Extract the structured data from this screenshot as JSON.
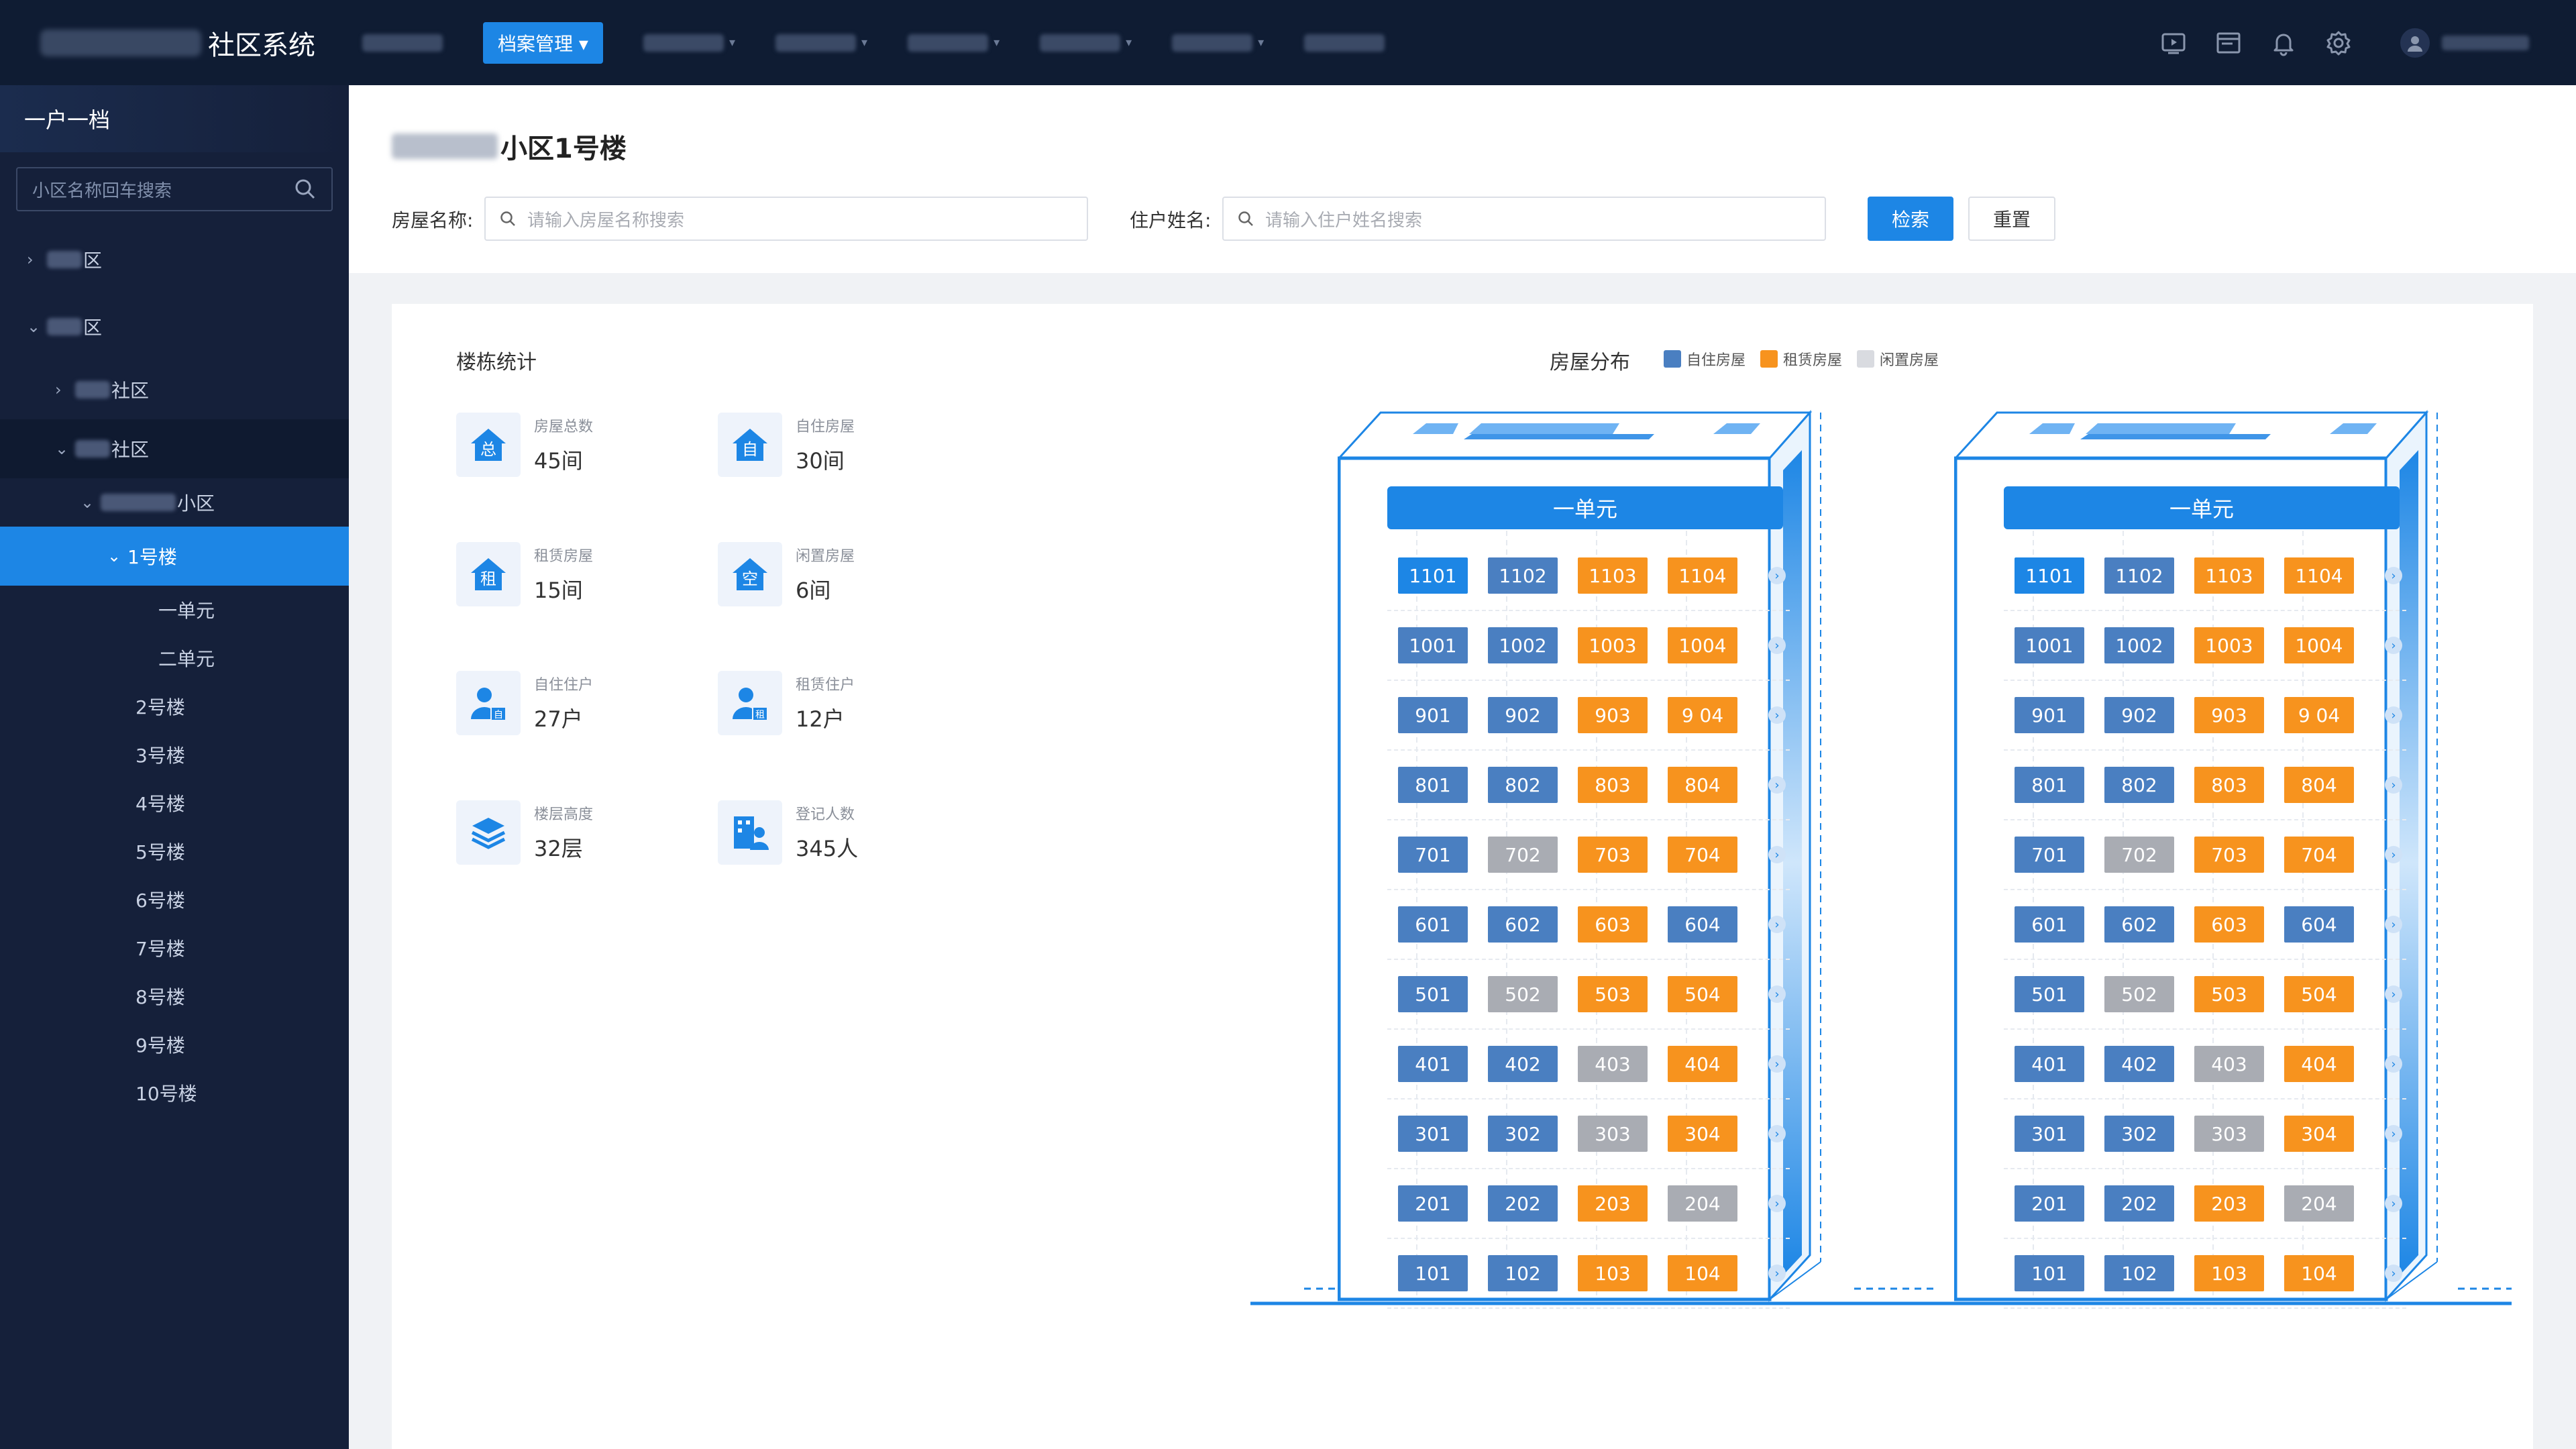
{
  "app": {
    "title_suffix": "社区系统"
  },
  "menu": {
    "active_label": "档案管理 ▾"
  },
  "sidebar": {
    "title": "一户一档",
    "search_placeholder": "小区名称回车搜索",
    "tree": [
      {
        "label": "区",
        "level": 0,
        "state": "collapsed"
      },
      {
        "label": "区",
        "level": 0,
        "state": "expanded"
      },
      {
        "label": "社区",
        "level": 1,
        "state": "collapsed"
      },
      {
        "label": "社区",
        "level": 1,
        "state": "expanded"
      },
      {
        "label": "小区",
        "level": 2,
        "state": "expanded"
      },
      {
        "label": "1号楼",
        "level": 3,
        "state": "selected"
      },
      {
        "label": "一单元",
        "level": 4
      },
      {
        "label": "二单元",
        "level": 4
      },
      {
        "label": "2号楼",
        "level": 3
      },
      {
        "label": "3号楼",
        "level": 3
      },
      {
        "label": "4号楼",
        "level": 3
      },
      {
        "label": "5号楼",
        "level": 3
      },
      {
        "label": "6号楼",
        "level": 3
      },
      {
        "label": "7号楼",
        "level": 3
      },
      {
        "label": "8号楼",
        "level": 3
      },
      {
        "label": "9号楼",
        "level": 3
      },
      {
        "label": "10号楼",
        "level": 3
      }
    ]
  },
  "page": {
    "title_suffix": "小区1号楼",
    "house_label": "房屋名称:",
    "house_placeholder": "请输入房屋名称搜索",
    "resident_label": "住户姓名:",
    "resident_placeholder": "请输入住户姓名搜索",
    "search_btn": "检索",
    "reset_btn": "重置"
  },
  "stats": {
    "title": "楼栋统计",
    "items": [
      {
        "icon": "总",
        "label": "房屋总数",
        "value": "45间"
      },
      {
        "icon": "自",
        "label": "自住房屋",
        "value": "30间"
      },
      {
        "icon": "租",
        "label": "租赁房屋",
        "value": "15间"
      },
      {
        "icon": "空",
        "label": "闲置房屋",
        "value": "6间"
      },
      {
        "icon": "person-self",
        "label": "自住住户",
        "value": "27户"
      },
      {
        "icon": "person-rent",
        "label": "租赁住户",
        "value": "12户"
      },
      {
        "icon": "layers",
        "label": "楼层高度",
        "value": "32层"
      },
      {
        "icon": "people",
        "label": "登记人数",
        "value": "345人"
      }
    ]
  },
  "distribution": {
    "title": "房屋分布",
    "legend": [
      {
        "label": "自住房屋",
        "color": "#4a7fc1"
      },
      {
        "label": "租赁房屋",
        "color": "#f7931e"
      },
      {
        "label": "闲置房屋",
        "color": "#d9dbe0"
      }
    ]
  },
  "buildings": [
    {
      "unit_label": "一单元",
      "floors": [
        [
          [
            "1101",
            "self-hl"
          ],
          [
            "1102",
            "self"
          ],
          [
            "1103",
            "rent"
          ],
          [
            "1104",
            "rent"
          ]
        ],
        [
          [
            "1001",
            "self"
          ],
          [
            "1002",
            "self"
          ],
          [
            "1003",
            "rent"
          ],
          [
            "1004",
            "rent"
          ]
        ],
        [
          [
            "901",
            "self"
          ],
          [
            "902",
            "self"
          ],
          [
            "903",
            "rent"
          ],
          [
            "9 04",
            "rent"
          ]
        ],
        [
          [
            "801",
            "self"
          ],
          [
            "802",
            "self"
          ],
          [
            "803",
            "rent"
          ],
          [
            "804",
            "rent"
          ]
        ],
        [
          [
            "701",
            "self"
          ],
          [
            "702",
            "idle"
          ],
          [
            "703",
            "rent"
          ],
          [
            "704",
            "rent"
          ]
        ],
        [
          [
            "601",
            "self"
          ],
          [
            "602",
            "self"
          ],
          [
            "603",
            "rent"
          ],
          [
            "604",
            "self"
          ]
        ],
        [
          [
            "501",
            "self"
          ],
          [
            "502",
            "idle"
          ],
          [
            "503",
            "rent"
          ],
          [
            "504",
            "rent"
          ]
        ],
        [
          [
            "401",
            "self"
          ],
          [
            "402",
            "self"
          ],
          [
            "403",
            "idle"
          ],
          [
            "404",
            "rent"
          ]
        ],
        [
          [
            "301",
            "self"
          ],
          [
            "302",
            "self"
          ],
          [
            "303",
            "idle"
          ],
          [
            "304",
            "rent"
          ]
        ],
        [
          [
            "201",
            "self"
          ],
          [
            "202",
            "self"
          ],
          [
            "203",
            "rent"
          ],
          [
            "204",
            "idle"
          ]
        ],
        [
          [
            "101",
            "self"
          ],
          [
            "102",
            "self"
          ],
          [
            "103",
            "rent"
          ],
          [
            "104",
            "rent"
          ]
        ]
      ]
    },
    {
      "unit_label": "一单元",
      "floors": [
        [
          [
            "1101",
            "self-hl"
          ],
          [
            "1102",
            "self"
          ],
          [
            "1103",
            "rent"
          ],
          [
            "1104",
            "rent"
          ]
        ],
        [
          [
            "1001",
            "self"
          ],
          [
            "1002",
            "self"
          ],
          [
            "1003",
            "rent"
          ],
          [
            "1004",
            "rent"
          ]
        ],
        [
          [
            "901",
            "self"
          ],
          [
            "902",
            "self"
          ],
          [
            "903",
            "rent"
          ],
          [
            "9 04",
            "rent"
          ]
        ],
        [
          [
            "801",
            "self"
          ],
          [
            "802",
            "self"
          ],
          [
            "803",
            "rent"
          ],
          [
            "804",
            "rent"
          ]
        ],
        [
          [
            "701",
            "self"
          ],
          [
            "702",
            "idle"
          ],
          [
            "703",
            "rent"
          ],
          [
            "704",
            "rent"
          ]
        ],
        [
          [
            "601",
            "self"
          ],
          [
            "602",
            "self"
          ],
          [
            "603",
            "rent"
          ],
          [
            "604",
            "self"
          ]
        ],
        [
          [
            "501",
            "self"
          ],
          [
            "502",
            "idle"
          ],
          [
            "503",
            "rent"
          ],
          [
            "504",
            "rent"
          ]
        ],
        [
          [
            "401",
            "self"
          ],
          [
            "402",
            "self"
          ],
          [
            "403",
            "idle"
          ],
          [
            "404",
            "rent"
          ]
        ],
        [
          [
            "301",
            "self"
          ],
          [
            "302",
            "self"
          ],
          [
            "303",
            "idle"
          ],
          [
            "304",
            "rent"
          ]
        ],
        [
          [
            "201",
            "self"
          ],
          [
            "202",
            "self"
          ],
          [
            "203",
            "rent"
          ],
          [
            "204",
            "idle"
          ]
        ],
        [
          [
            "101",
            "self"
          ],
          [
            "102",
            "self"
          ],
          [
            "103",
            "rent"
          ],
          [
            "104",
            "rent"
          ]
        ]
      ]
    }
  ]
}
